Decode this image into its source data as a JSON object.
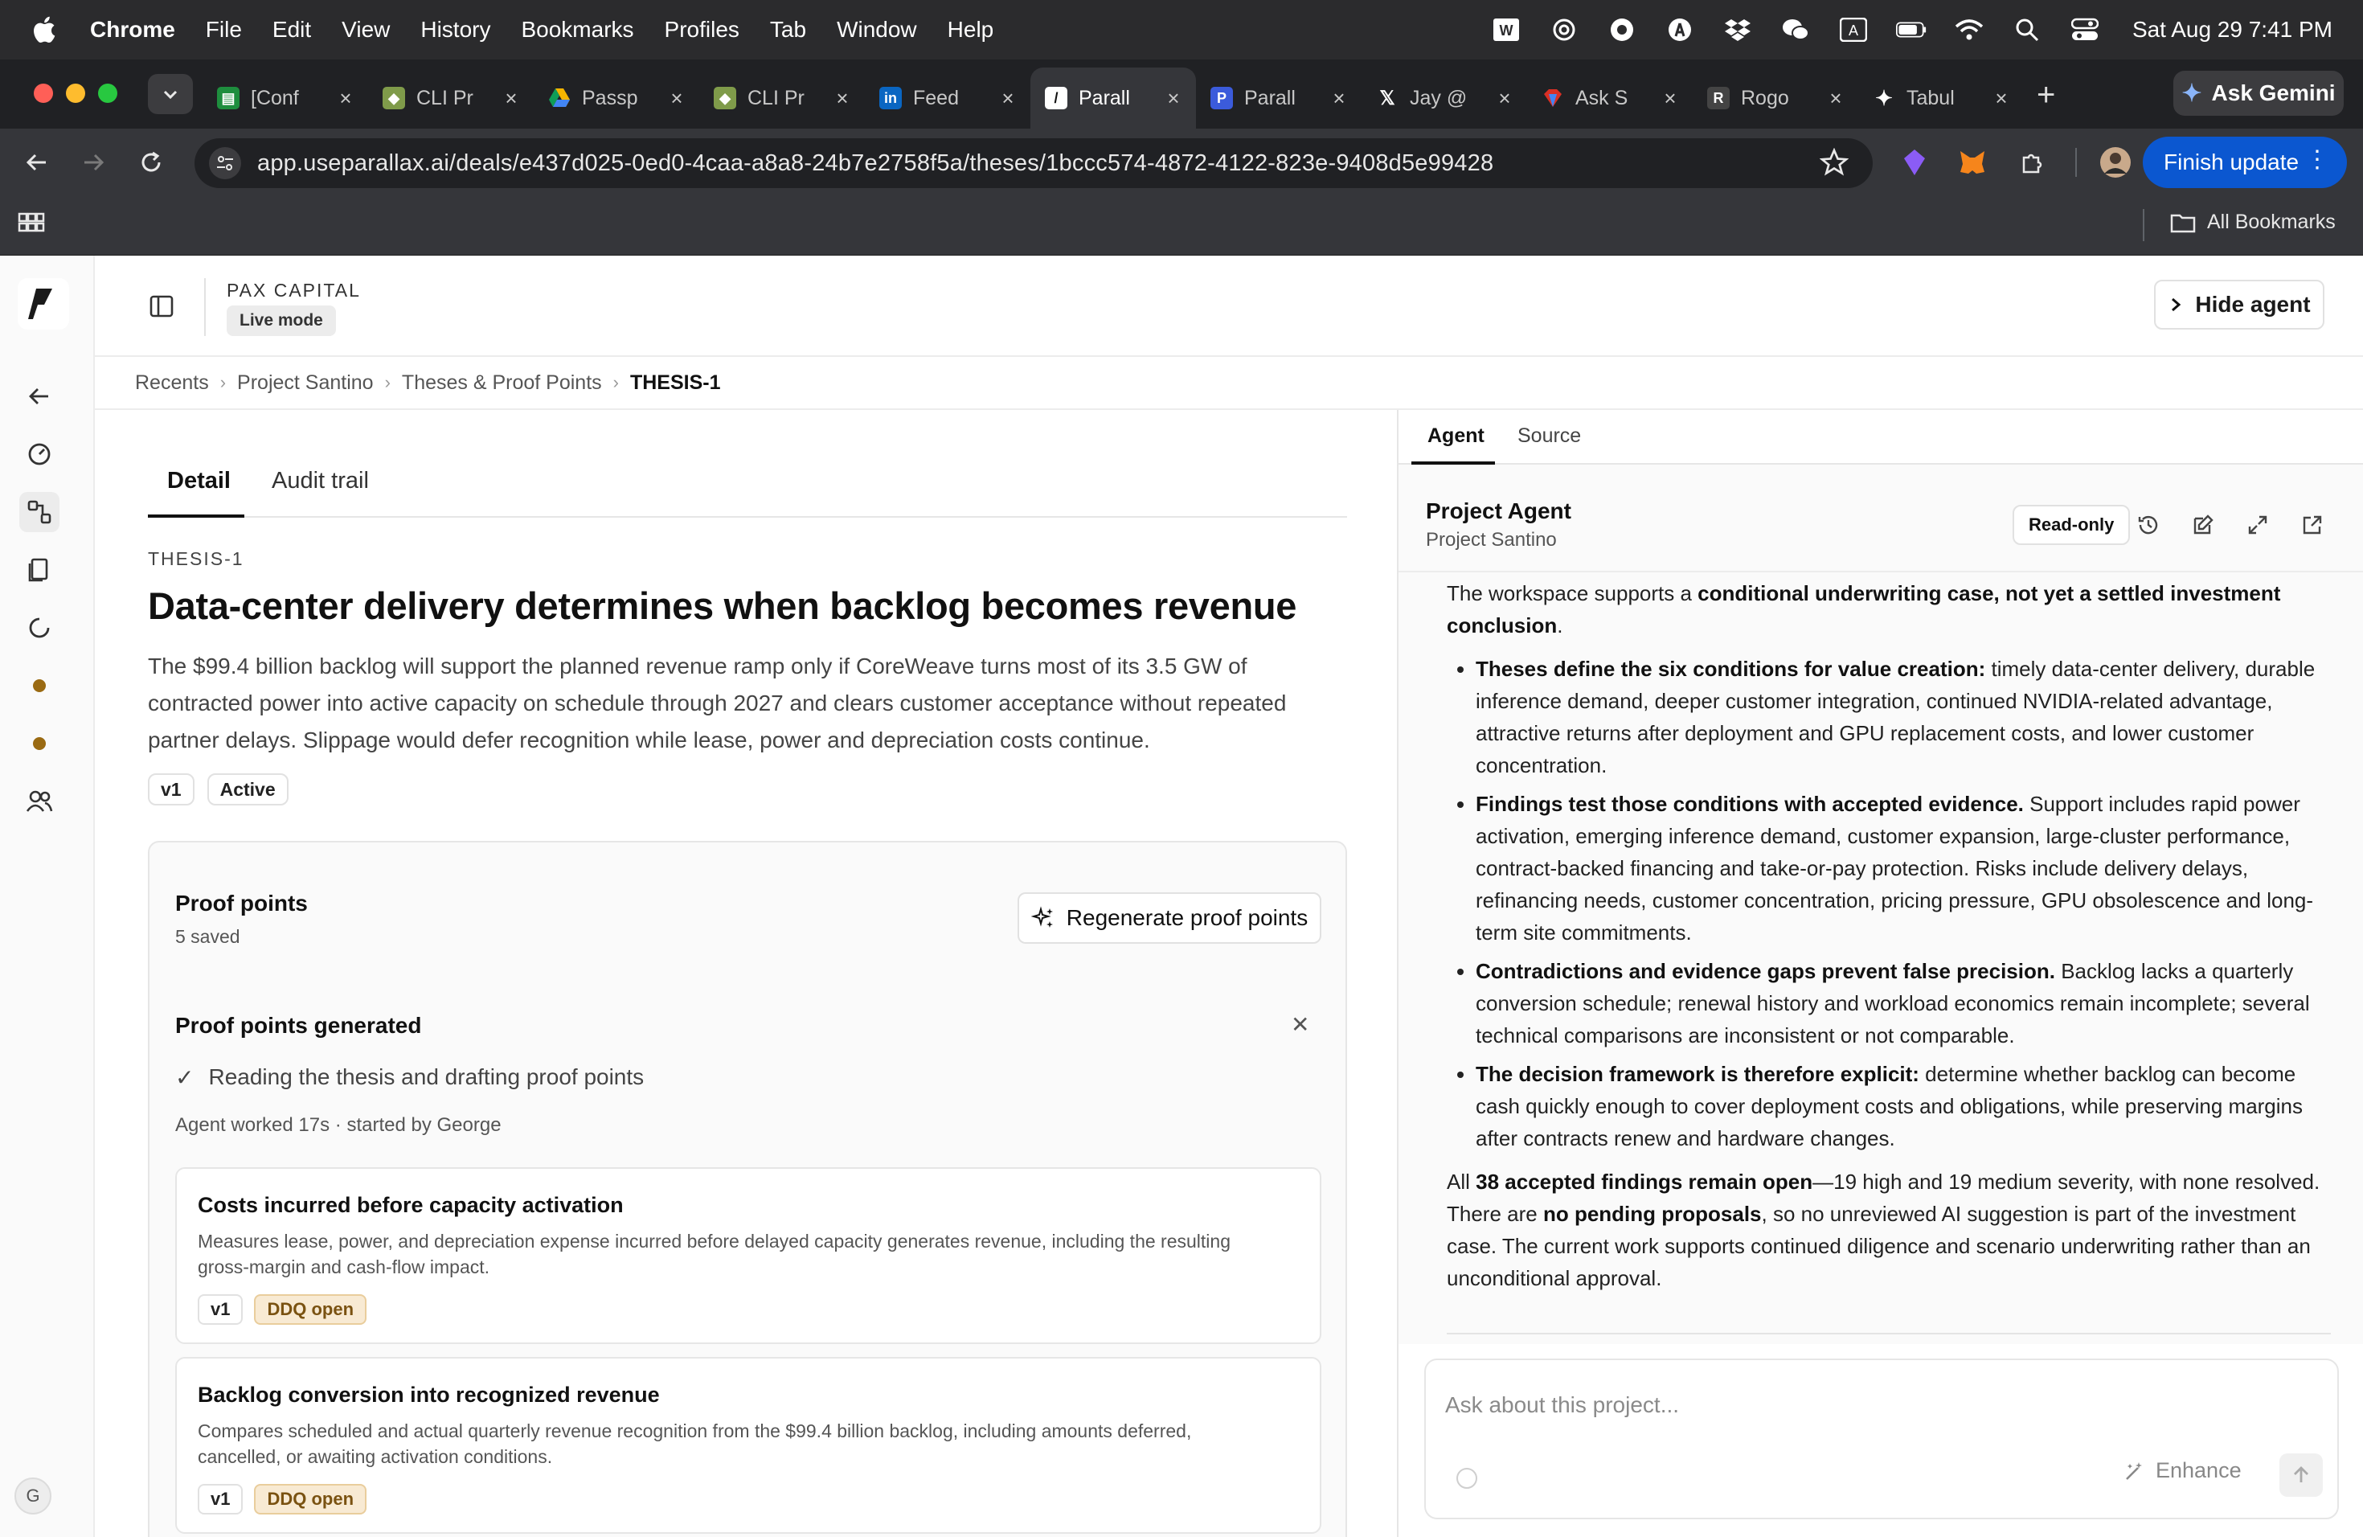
{
  "menubar": {
    "app": "Chrome",
    "items": [
      "File",
      "Edit",
      "View",
      "History",
      "Bookmarks",
      "Profiles",
      "Tab",
      "Window",
      "Help"
    ],
    "input_source": "A",
    "clock": "Sat Aug 29  7:41 PM"
  },
  "tabs": [
    {
      "label": "[Conf",
      "favicon": "sheets-icon",
      "color": "#1e8e3e"
    },
    {
      "label": "CLI Pr",
      "favicon": "notebook-icon",
      "color": "#7f9b4a"
    },
    {
      "label": "Passp",
      "favicon": "drive-icon",
      "color": "#f4b400"
    },
    {
      "label": "CLI Pr",
      "favicon": "notebook-icon",
      "color": "#7f9b4a"
    },
    {
      "label": "Feed",
      "favicon": "linkedin-icon",
      "color": "#0a66c2"
    },
    {
      "label": "Parall",
      "favicon": "parallax-icon",
      "color": "#111111",
      "active": true
    },
    {
      "label": "Parall",
      "favicon": "parallax-blue-icon",
      "color": "#3b5bdb"
    },
    {
      "label": "Jay @",
      "favicon": "x-icon",
      "color": "#000000"
    },
    {
      "label": "Ask S",
      "favicon": "ask-icon",
      "color": "#d93025"
    },
    {
      "label": "Rogo",
      "favicon": "rogo-icon",
      "color": "#444444"
    },
    {
      "label": "Tabul",
      "favicon": "sparkle-icon",
      "color": "#ffffff"
    }
  ],
  "ask_gemini": "Ask Gemini",
  "address": {
    "url": "app.useparallax.ai/deals/e437d025-0ed0-4caa-a8a8-24b7e2758f5a/theses/1bccc574-4872-4122-823e-9408d5e99428"
  },
  "finish_update": "Finish update",
  "bookmarks": {
    "all": "All Bookmarks"
  },
  "app": {
    "org": "PAX CAPITAL",
    "mode": "Live mode",
    "hide_agent": "Hide agent",
    "avatar_initial": "G"
  },
  "breadcrumb": [
    "Recents",
    "Project Santino",
    "Theses & Proof Points",
    "THESIS-1"
  ],
  "detail": {
    "tabs": [
      "Detail",
      "Audit trail"
    ],
    "thesis_id": "THESIS-1",
    "title": "Data-center delivery determines when backlog becomes revenue",
    "body": "The $99.4 billion backlog will support the planned revenue ramp only if CoreWeave turns most of its 3.5 GW of contracted power into active capacity on schedule through 2027 and clears customer acceptance without repeated partner delays. Slippage would defer recognition while lease, power and depreciation costs continue.",
    "badges": [
      "v1",
      "Active"
    ]
  },
  "proof_points": {
    "title": "Proof points",
    "saved": "5 saved",
    "regenerate": "Regenerate proof points",
    "generated_title": "Proof points generated",
    "step": "Reading the thesis and drafting proof points",
    "meta": "Agent worked 17s · started by George",
    "items": [
      {
        "title": "Costs incurred before capacity activation",
        "desc": "Measures lease, power, and depreciation expense incurred before delayed capacity generates revenue, including the resulting gross-margin and cash-flow impact.",
        "version": "v1",
        "status": "DDQ open"
      },
      {
        "title": "Backlog conversion into recognized revenue",
        "desc": "Compares scheduled and actual quarterly revenue recognition from the $99.4 billion backlog, including amounts deferred, cancelled, or awaiting activation conditions.",
        "version": "v1",
        "status": "DDQ open"
      }
    ]
  },
  "agent": {
    "tabs": [
      "Agent",
      "Source"
    ],
    "title": "Project Agent",
    "subtitle": "Project Santino",
    "readonly": "Read-only",
    "intro_a": "The workspace supports a ",
    "intro_b": "conditional underwriting case, not yet a settled investment conclusion",
    "intro_c": ".",
    "bullets": [
      {
        "lead": "Theses define the six conditions for value creation:",
        "text": " timely data-center delivery, durable inference demand, deeper customer integration, continued NVIDIA-related advantage, attractive returns after deployment and GPU replacement costs, and lower customer concentration."
      },
      {
        "lead": "Findings test those conditions with accepted evidence.",
        "text": " Support includes rapid power activation, emerging inference demand, customer expansion, large-cluster performance, contract-backed financing and take-or-pay protection. Risks include delivery delays, refinancing needs, customer concentration, pricing pressure, GPU obsolescence and long-term site commitments."
      },
      {
        "lead": "Contradictions and evidence gaps prevent false precision.",
        "text": " Backlog lacks a quarterly conversion schedule; renewal history and workload economics remain incomplete; several technical comparisons are inconsistent or not comparable."
      },
      {
        "lead": "The decision framework is therefore explicit:",
        "text": " determine whether backlog can become cash quickly enough to cover deployment costs and obligations, while preserving margins after contracts renew and hardware changes."
      }
    ],
    "closing_a": "All ",
    "closing_b": "38 accepted findings remain open",
    "closing_c": "—19 high and 19 medium severity, with none resolved. There are ",
    "closing_d": "no pending proposals",
    "closing_e": ", so no unreviewed AI suggestion is part of the investment case. The current work supports continued diligence and scenario underwriting rather than an unconditional approval.",
    "composer_placeholder": "Ask about this project...",
    "enhance": "Enhance"
  }
}
